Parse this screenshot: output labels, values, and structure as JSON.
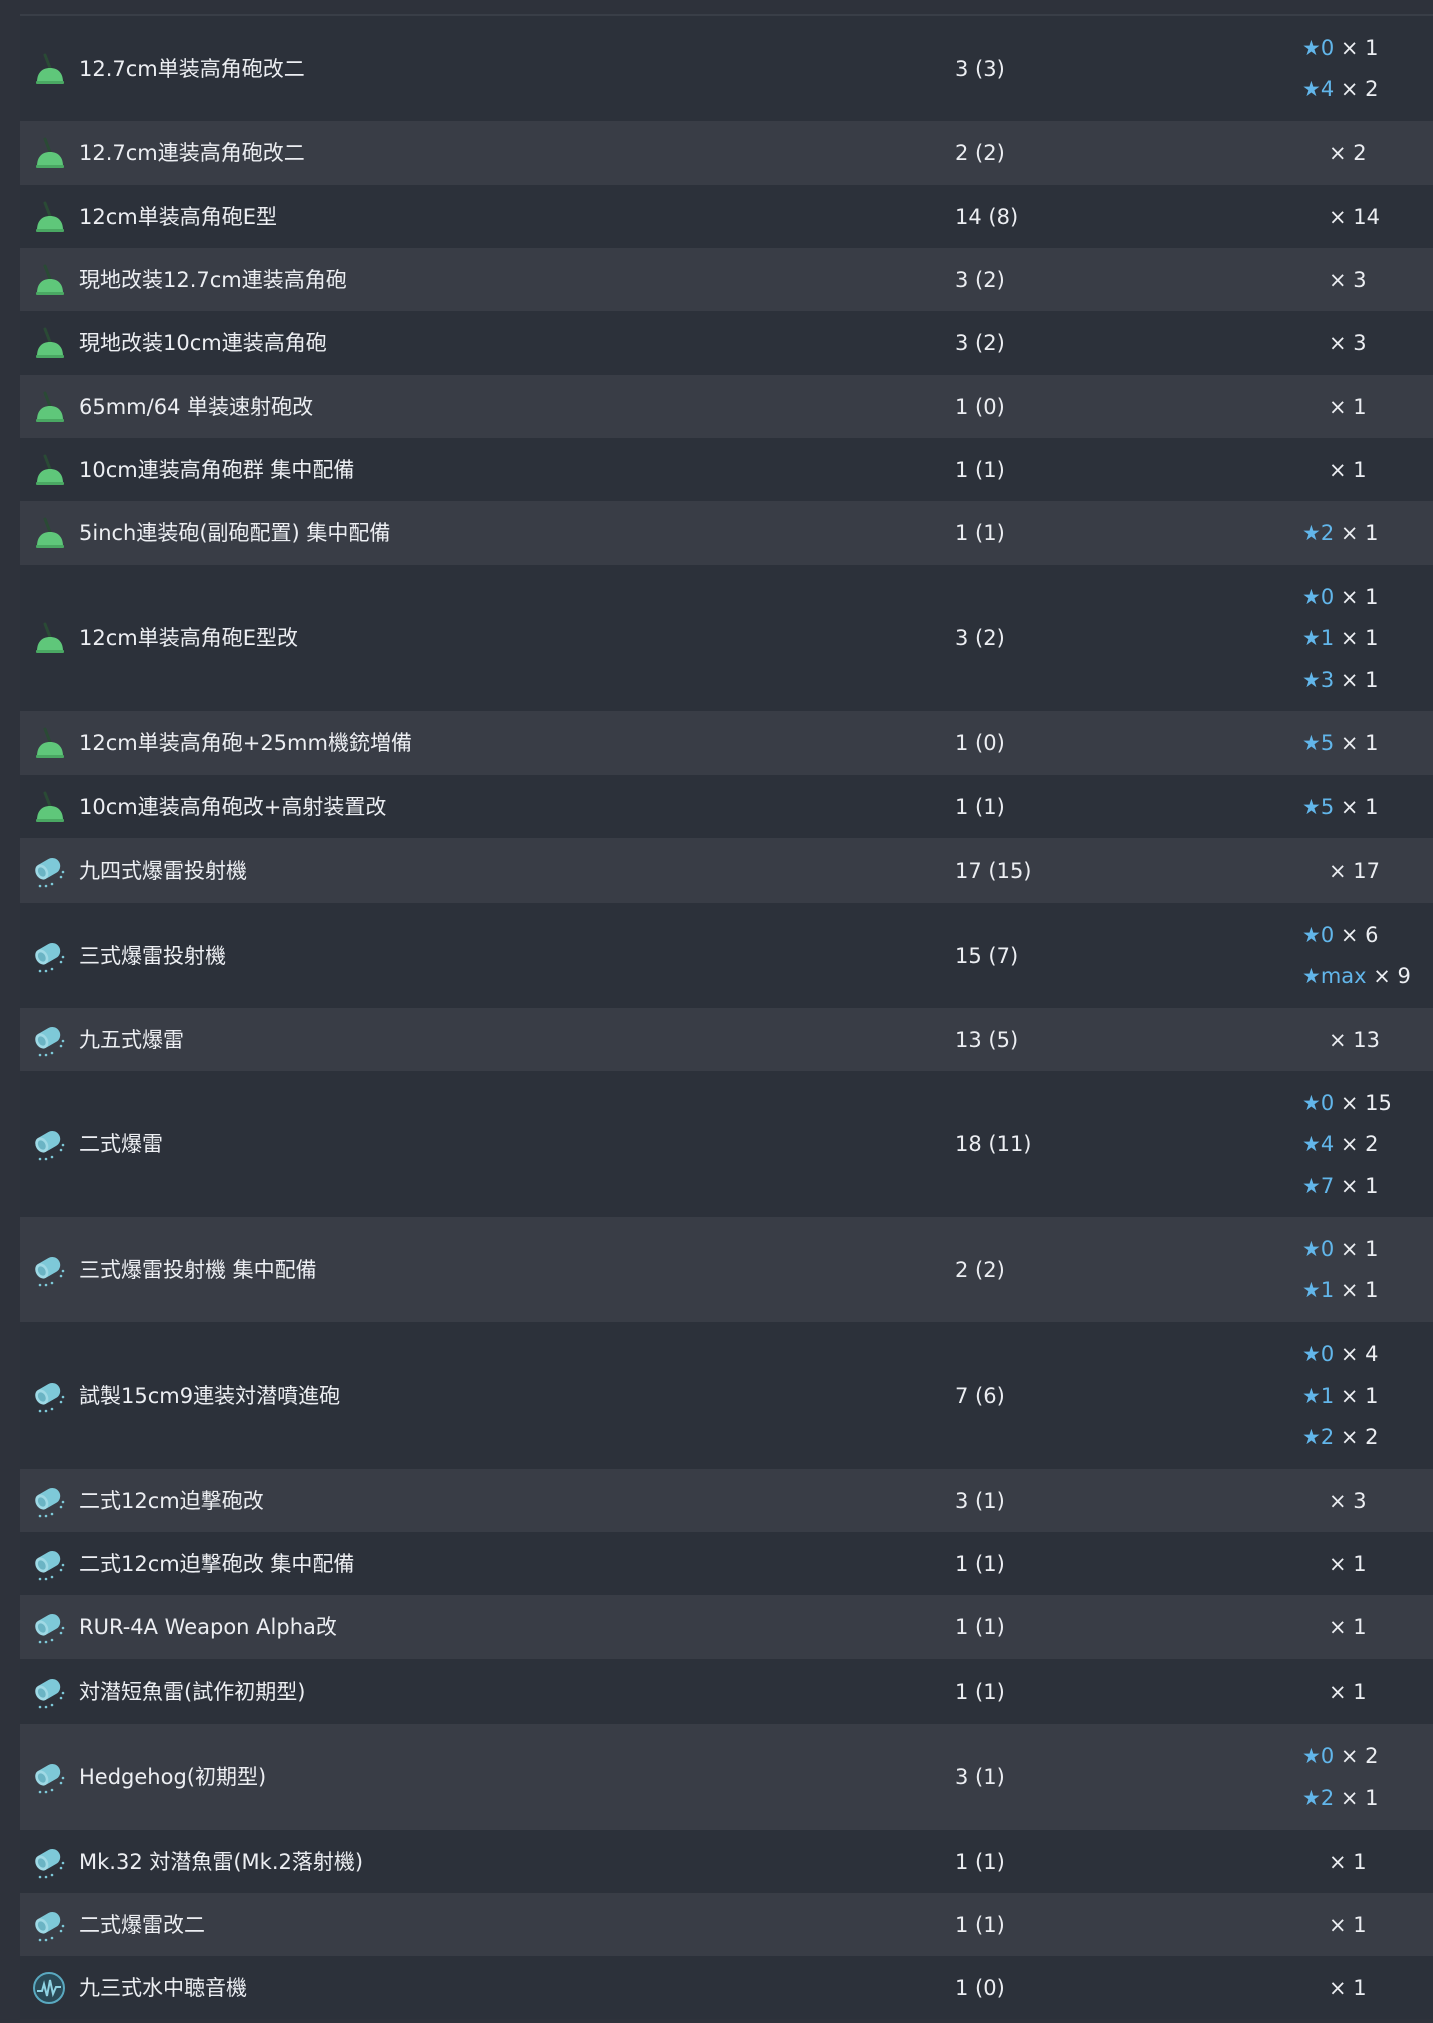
{
  "theme": {
    "star_color": "#62b6ea",
    "row_dark": "#2c313a",
    "row_light": "#393d46",
    "text": "#eceef2"
  },
  "rows": [
    {
      "icon": "aa-gun-icon",
      "name": "12.7cm単装高角砲改二",
      "count": "3 (3)",
      "improvements": [
        {
          "star": "★0",
          "mult": "× 1"
        },
        {
          "star": "★4",
          "mult": "× 2"
        }
      ]
    },
    {
      "icon": "aa-gun-icon",
      "name": "12.7cm連装高角砲改二",
      "count": "2 (2)",
      "improvements": [
        {
          "star": "",
          "mult": "× 2"
        }
      ]
    },
    {
      "icon": "aa-gun-icon",
      "name": "12cm単装高角砲E型",
      "count": "14 (8)",
      "improvements": [
        {
          "star": "",
          "mult": "× 14"
        }
      ]
    },
    {
      "icon": "aa-gun-icon",
      "name": "現地改装12.7cm連装高角砲",
      "count": "3 (2)",
      "improvements": [
        {
          "star": "",
          "mult": "× 3"
        }
      ]
    },
    {
      "icon": "aa-gun-icon",
      "name": "現地改装10cm連装高角砲",
      "count": "3 (2)",
      "improvements": [
        {
          "star": "",
          "mult": "× 3"
        }
      ]
    },
    {
      "icon": "aa-gun-icon",
      "name": "65mm/64 単装速射砲改",
      "count": "1 (0)",
      "improvements": [
        {
          "star": "",
          "mult": "× 1"
        }
      ]
    },
    {
      "icon": "aa-gun-icon",
      "name": "10cm連装高角砲群 集中配備",
      "count": "1 (1)",
      "improvements": [
        {
          "star": "",
          "mult": "× 1"
        }
      ]
    },
    {
      "icon": "aa-gun-icon",
      "name": "5inch連装砲(副砲配置) 集中配備",
      "count": "1 (1)",
      "improvements": [
        {
          "star": "★2",
          "mult": "× 1"
        }
      ]
    },
    {
      "icon": "aa-gun-icon",
      "name": "12cm単装高角砲E型改",
      "count": "3 (2)",
      "improvements": [
        {
          "star": "★0",
          "mult": "× 1"
        },
        {
          "star": "★1",
          "mult": "× 1"
        },
        {
          "star": "★3",
          "mult": "× 1"
        }
      ]
    },
    {
      "icon": "aa-gun-icon",
      "name": "12cm単装高角砲+25mm機銃増備",
      "count": "1 (0)",
      "improvements": [
        {
          "star": "★5",
          "mult": "× 1"
        }
      ]
    },
    {
      "icon": "aa-gun-icon",
      "name": "10cm連装高角砲改+高射装置改",
      "count": "1 (1)",
      "improvements": [
        {
          "star": "★5",
          "mult": "× 1"
        }
      ]
    },
    {
      "icon": "depth-charge-icon",
      "name": "九四式爆雷投射機",
      "count": "17 (15)",
      "improvements": [
        {
          "star": "",
          "mult": "× 17"
        }
      ]
    },
    {
      "icon": "depth-charge-icon",
      "name": "三式爆雷投射機",
      "count": "15 (7)",
      "improvements": [
        {
          "star": "★0",
          "mult": "× 6"
        },
        {
          "star": "★max",
          "mult": "× 9"
        }
      ]
    },
    {
      "icon": "depth-charge-icon",
      "name": "九五式爆雷",
      "count": "13 (5)",
      "improvements": [
        {
          "star": "",
          "mult": "× 13"
        }
      ]
    },
    {
      "icon": "depth-charge-icon",
      "name": "二式爆雷",
      "count": "18 (11)",
      "improvements": [
        {
          "star": "★0",
          "mult": "× 15"
        },
        {
          "star": "★4",
          "mult": "× 2"
        },
        {
          "star": "★7",
          "mult": "× 1"
        }
      ]
    },
    {
      "icon": "depth-charge-icon",
      "name": "三式爆雷投射機 集中配備",
      "count": "2 (2)",
      "improvements": [
        {
          "star": "★0",
          "mult": "× 1"
        },
        {
          "star": "★1",
          "mult": "× 1"
        }
      ]
    },
    {
      "icon": "depth-charge-icon",
      "name": "試製15cm9連装対潜噴進砲",
      "count": "7 (6)",
      "improvements": [
        {
          "star": "★0",
          "mult": "× 4"
        },
        {
          "star": "★1",
          "mult": "× 1"
        },
        {
          "star": "★2",
          "mult": "× 2"
        }
      ]
    },
    {
      "icon": "depth-charge-icon",
      "name": "二式12cm迫撃砲改",
      "count": "3 (1)",
      "improvements": [
        {
          "star": "",
          "mult": "× 3"
        }
      ]
    },
    {
      "icon": "depth-charge-icon",
      "name": "二式12cm迫撃砲改 集中配備",
      "count": "1 (1)",
      "improvements": [
        {
          "star": "",
          "mult": "× 1"
        }
      ]
    },
    {
      "icon": "depth-charge-icon",
      "name": "RUR-4A Weapon Alpha改",
      "count": "1 (1)",
      "improvements": [
        {
          "star": "",
          "mult": "× 1"
        }
      ]
    },
    {
      "icon": "depth-charge-icon",
      "name": "対潜短魚雷(試作初期型)",
      "count": "1 (1)",
      "improvements": [
        {
          "star": "",
          "mult": "× 1"
        }
      ]
    },
    {
      "icon": "depth-charge-icon",
      "name": "Hedgehog(初期型)",
      "count": "3 (1)",
      "improvements": [
        {
          "star": "★0",
          "mult": "× 2"
        },
        {
          "star": "★2",
          "mult": "× 1"
        }
      ]
    },
    {
      "icon": "depth-charge-icon",
      "name": "Mk.32 対潜魚雷(Mk.2落射機)",
      "count": "1 (1)",
      "improvements": [
        {
          "star": "",
          "mult": "× 1"
        }
      ]
    },
    {
      "icon": "depth-charge-icon",
      "name": "二式爆雷改二",
      "count": "1 (1)",
      "improvements": [
        {
          "star": "",
          "mult": "× 1"
        }
      ]
    },
    {
      "icon": "sonar-icon",
      "name": "九三式水中聴音機",
      "count": "1 (0)",
      "improvements": [
        {
          "star": "",
          "mult": "× 1"
        }
      ]
    }
  ]
}
